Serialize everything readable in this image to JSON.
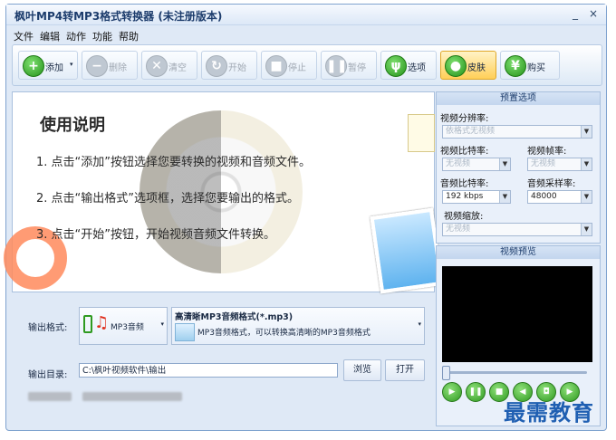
{
  "window": {
    "title": "枫叶MP4转MP3格式转换器   (未注册版本)",
    "minimize": "_",
    "close": "×"
  },
  "menu": [
    "文件",
    "编辑",
    "动作",
    "功能",
    "帮助"
  ],
  "toolbar": {
    "add": "添加",
    "delete": "删除",
    "clear": "清空",
    "start": "开始",
    "stop": "停止",
    "pause": "暂停",
    "options": "选项",
    "skin": "皮肤",
    "buy": "购买"
  },
  "help": {
    "title": "使用说明",
    "line1": "1. 点击“添加”按钮选择您要转换的视频和音频文件。",
    "line2": "2. 点击“输出格式”选项框，选择您要输出的格式。",
    "line3": "3. 点击“开始”按钮，开始视频音频文件转换。"
  },
  "output": {
    "format_label": "输出格式:",
    "format_value": "MP3音频",
    "preset_title": "高清晰MP3音频格式(*.mp3)",
    "preset_desc": "MP3音频格式，可以转换高清晰的MP3音频格式",
    "dir_label": "输出目录:",
    "dir_value": "C:\\枫叶视频软件\\输出",
    "browse": "浏览",
    "open": "打开"
  },
  "presets": {
    "title": "预置选项",
    "resolution_label": "视频分辨率:",
    "resolution_value": "依格式无视频",
    "vbitrate_label": "视频比特率:",
    "vbitrate_value": "无视频",
    "framerate_label": "视频帧率:",
    "framerate_value": "无视频",
    "abitrate_label": "音频比特率:",
    "abitrate_value": "192 kbps",
    "samplerate_label": "音频采样率:",
    "samplerate_value": "48000",
    "scale_label": "视频缩放:",
    "scale_value": "无视频"
  },
  "preview": {
    "title": "视频预览"
  },
  "watermark": "最需教育"
}
